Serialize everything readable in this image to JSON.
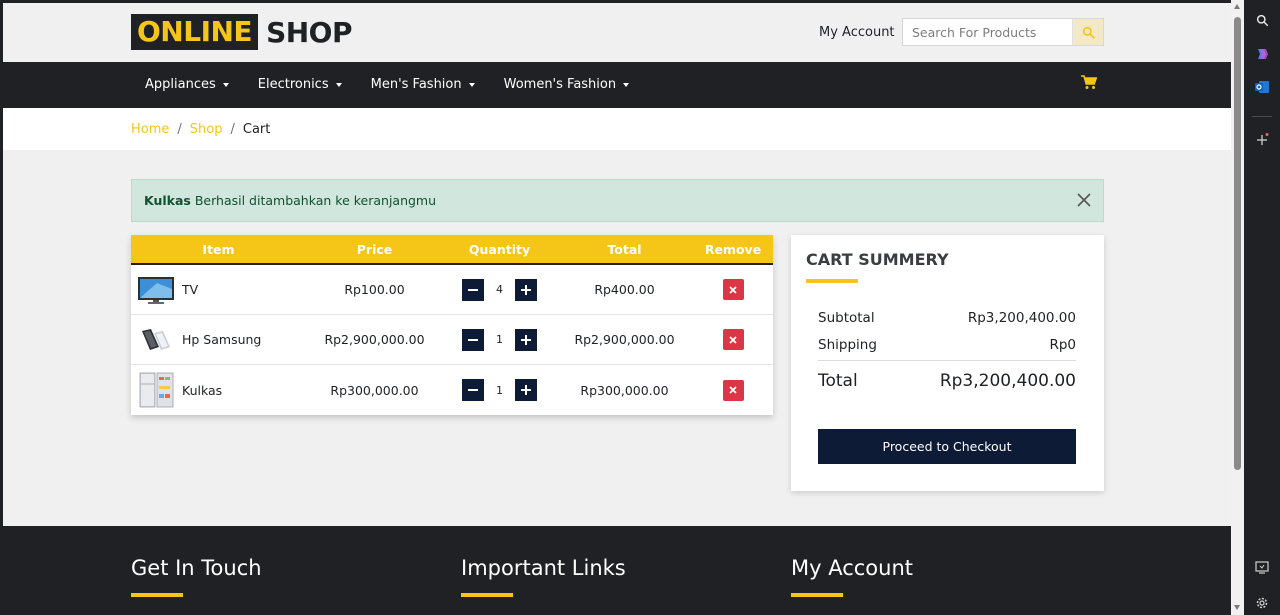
{
  "header": {
    "logo_part1": "ONLINE",
    "logo_part2": "SHOP",
    "my_account": "My Account",
    "search_placeholder": "Search For Products"
  },
  "nav": {
    "items": [
      {
        "label": "Appliances"
      },
      {
        "label": "Electronics"
      },
      {
        "label": "Men's Fashion"
      },
      {
        "label": "Women's Fashion"
      }
    ]
  },
  "breadcrumb": {
    "home": "Home",
    "shop": "Shop",
    "current": "Cart",
    "separator": "/"
  },
  "alert": {
    "product": "Kulkas",
    "message": "Berhasil ditambahkan ke keranjangmu"
  },
  "cart": {
    "headers": {
      "item": "Item",
      "price": "Price",
      "quantity": "Quantity",
      "total": "Total",
      "remove": "Remove"
    },
    "rows": [
      {
        "name": "TV",
        "price": "Rp100.00",
        "qty": "4",
        "total": "Rp400.00",
        "thumb": "tv-icon"
      },
      {
        "name": "Hp Samsung",
        "price": "Rp2,900,000.00",
        "qty": "1",
        "total": "Rp2,900,000.00",
        "thumb": "phone-icon"
      },
      {
        "name": "Kulkas",
        "price": "Rp300,000.00",
        "qty": "1",
        "total": "Rp300,000.00",
        "thumb": "fridge-icon"
      }
    ]
  },
  "summary": {
    "title": "CART SUMMERY",
    "subtotal_label": "Subtotal",
    "subtotal_value": "Rp3,200,400.00",
    "shipping_label": "Shipping",
    "shipping_value": "Rp0",
    "total_label": "Total",
    "total_value": "Rp3,200,400.00",
    "checkout_label": "Proceed to Checkout"
  },
  "footer": {
    "col1": "Get In Touch",
    "col2": "Important Links",
    "col3": "My Account"
  },
  "colors": {
    "accent": "#f5c518",
    "dark": "#1f2125",
    "navy": "#0d1b36",
    "danger": "#dc3545",
    "alert_bg": "#d1e7dd"
  }
}
